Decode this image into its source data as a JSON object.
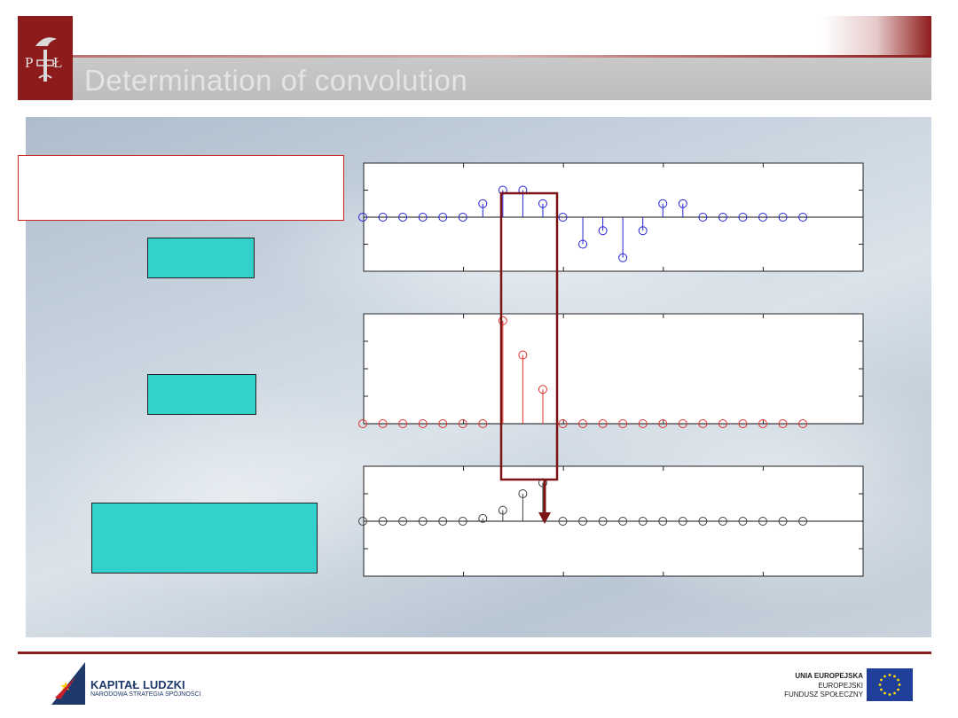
{
  "header": {
    "title": "Determination of convolution",
    "logo_letters": "PŁ"
  },
  "colors": {
    "brand": "#8e1b1b",
    "cyan_box": "#33d1cc",
    "signal_blue": "#2323d6",
    "signal_red": "#e0302a",
    "result": "#404040"
  },
  "chart_data": [
    {
      "type": "stem",
      "role": "top-signal",
      "color": "#2323d6",
      "x": [
        0,
        1,
        2,
        3,
        4,
        5,
        6,
        7,
        8,
        9,
        10,
        11,
        12,
        13,
        14,
        15,
        16,
        17,
        18,
        19,
        20,
        21,
        22
      ],
      "values": [
        0,
        0,
        0,
        0,
        0,
        0,
        0.5,
        1,
        1,
        0.5,
        0,
        -1,
        -0.5,
        -1.5,
        -0.5,
        0.5,
        0.5,
        0,
        0,
        0,
        0,
        0,
        0
      ],
      "ylim": [
        -2,
        2
      ]
    },
    {
      "type": "stem",
      "role": "middle-signal",
      "color": "#e0302a",
      "x": [
        0,
        1,
        2,
        3,
        4,
        5,
        6,
        7,
        8,
        9,
        10,
        11,
        12,
        13,
        14,
        15,
        16,
        17,
        18,
        19,
        20,
        21,
        22
      ],
      "values": [
        0,
        0,
        0,
        0,
        0,
        0,
        0,
        3,
        2,
        1,
        0,
        0,
        0,
        0,
        0,
        0,
        0,
        0,
        0,
        0,
        0,
        0,
        0
      ],
      "ylim": [
        0,
        3.2
      ]
    },
    {
      "type": "stem",
      "role": "result",
      "color": "#404040",
      "x": [
        0,
        1,
        2,
        3,
        4,
        5,
        6,
        7,
        8,
        9,
        10,
        11,
        12,
        13,
        14,
        15,
        16,
        17,
        18,
        19,
        20,
        21,
        22
      ],
      "values": [
        0,
        0,
        0,
        0,
        0,
        0,
        0.5,
        2,
        5,
        7,
        0,
        0,
        0,
        0,
        0,
        0,
        0,
        0,
        0,
        0,
        0,
        0,
        0
      ],
      "visible_count": 10,
      "ylim": [
        -10,
        10
      ]
    }
  ],
  "footer": {
    "kl_title": "KAPITAŁ LUDZKI",
    "kl_subtitle": "NARODOWA STRATEGIA SPÓJNOŚCI",
    "eu_line1": "UNIA EUROPEJSKA",
    "eu_line2": "EUROPEJSKI",
    "eu_line3": "FUNDUSZ SPOŁECZNY"
  }
}
